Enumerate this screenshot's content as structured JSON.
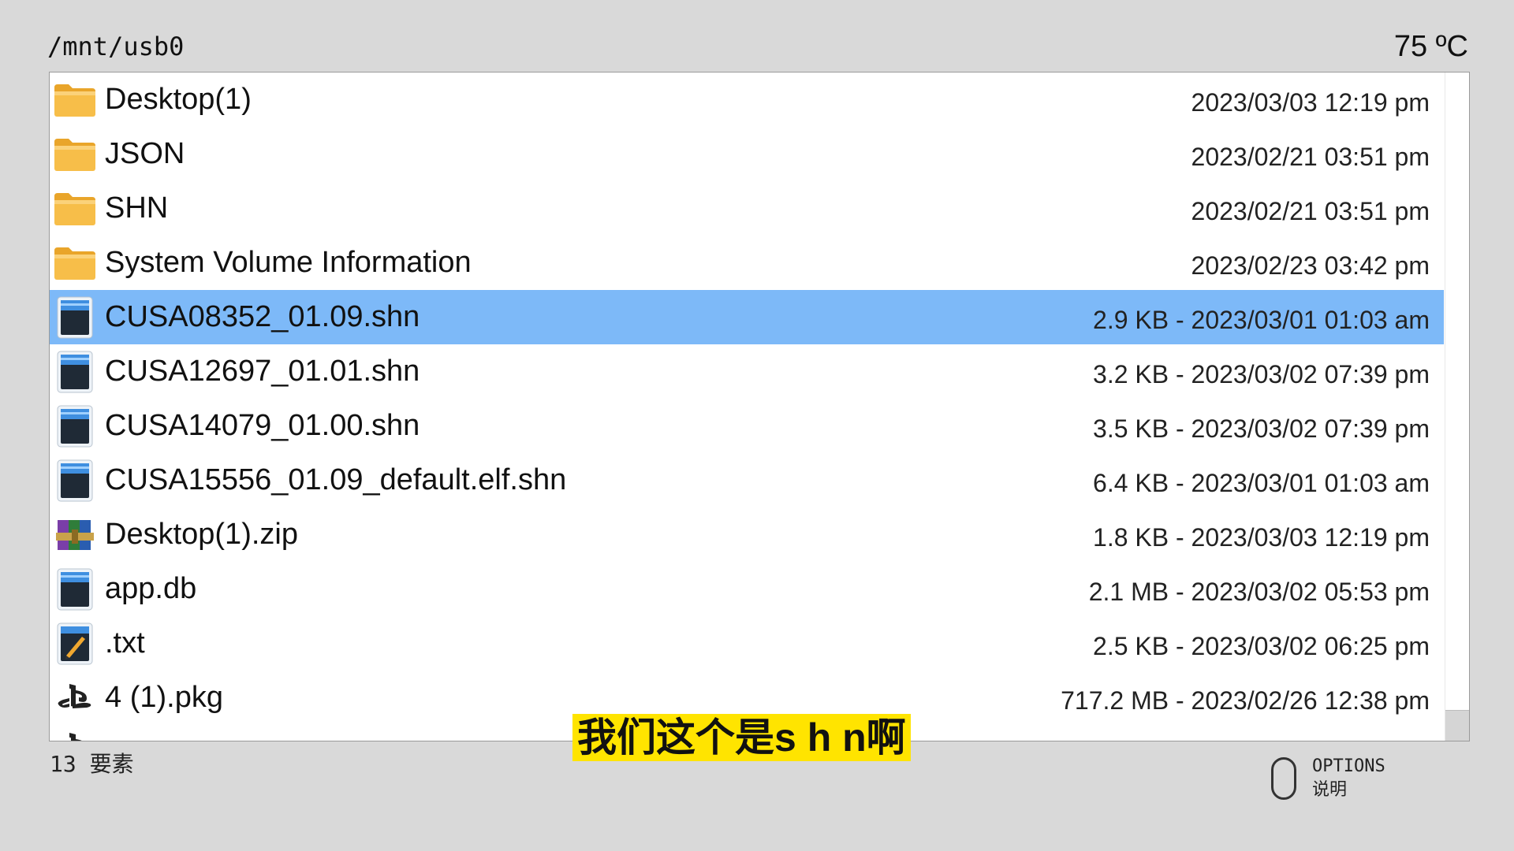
{
  "header": {
    "path": "/mnt/usb0",
    "temperature": "75 ºC"
  },
  "files": [
    {
      "icon": "folder-icon",
      "name": "Desktop(1)",
      "meta": "2023/03/03 12:19 pm",
      "selected": false
    },
    {
      "icon": "folder-icon",
      "name": "JSON",
      "meta": "2023/02/21 03:51 pm",
      "selected": false
    },
    {
      "icon": "folder-icon",
      "name": "SHN",
      "meta": "2023/02/21 03:51 pm",
      "selected": false
    },
    {
      "icon": "folder-icon",
      "name": "System Volume Information",
      "meta": "2023/02/23 03:42 pm",
      "selected": false
    },
    {
      "icon": "file-icon",
      "name": "CUSA08352_01.09.shn",
      "meta": "2.9 KB - 2023/03/01 01:03 am",
      "selected": true
    },
    {
      "icon": "file-icon",
      "name": "CUSA12697_01.01.shn",
      "meta": "3.2 KB - 2023/03/02 07:39 pm",
      "selected": false
    },
    {
      "icon": "file-icon",
      "name": "CUSA14079_01.00.shn",
      "meta": "3.5 KB - 2023/03/02 07:39 pm",
      "selected": false
    },
    {
      "icon": "file-icon",
      "name": "CUSA15556_01.09_default.elf.shn",
      "meta": "6.4 KB - 2023/03/01 01:03 am",
      "selected": false
    },
    {
      "icon": "archive-icon",
      "name": "Desktop(1).zip",
      "meta": "1.8 KB - 2023/03/03 12:19 pm",
      "selected": false
    },
    {
      "icon": "file-icon",
      "name": "app.db",
      "meta": "2.1 MB - 2023/03/02 05:53 pm",
      "selected": false
    },
    {
      "icon": "text-file-icon",
      "name": ".txt",
      "meta": "2.5 KB - 2023/03/02 06:25 pm",
      "selected": false
    },
    {
      "icon": "playstation-icon",
      "name": "4 (1).pkg",
      "meta": "717.2 MB - 2023/02/26 12:38 pm",
      "selected": false
    }
  ],
  "footer": {
    "item_count": "13 要素",
    "options_label": "OPTIONS",
    "options_desc": "说明"
  },
  "subtitle": "我们这个是s h n啊",
  "colors": {
    "background": "#d9d9d9",
    "selection": "#7db9f8",
    "subtitle_bg": "#ffe400",
    "folder": "#f6b93b"
  }
}
